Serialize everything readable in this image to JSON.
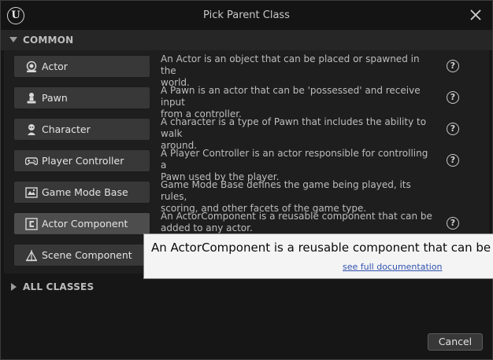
{
  "window": {
    "title": "Pick Parent Class",
    "logo_text": "U"
  },
  "sections": {
    "common": "COMMON",
    "all_classes": "ALL CLASSES"
  },
  "classes": [
    {
      "label": "Actor",
      "icon": "actor-icon",
      "desc1": "An Actor is an object that can be placed or spawned in the",
      "desc2": "world.",
      "help": "?"
    },
    {
      "label": "Pawn",
      "icon": "pawn-icon",
      "desc1": "A Pawn is an actor that can be 'possessed' and receive input",
      "desc2": "from a controller.",
      "help": "?"
    },
    {
      "label": "Character",
      "icon": "character-icon",
      "desc1": "A character is a type of Pawn that includes the ability to walk",
      "desc2": "around.",
      "help": "?"
    },
    {
      "label": "Player Controller",
      "icon": "gamepad-icon",
      "desc1": "A Player Controller is an actor responsible for controlling a",
      "desc2": "Pawn used by the player.",
      "help": "?"
    },
    {
      "label": "Game Mode Base",
      "icon": "game-mode-icon",
      "desc1": "Game Mode Base defines the game being played, its rules,",
      "desc2": "scoring, and other facets of the game type.",
      "help": ""
    },
    {
      "label": "Actor Component",
      "icon": "actor-component-icon",
      "desc1": "An ActorComponent is a reusable component that can be",
      "desc2": "added to any actor.",
      "help": "?"
    },
    {
      "label": "Scene Component",
      "icon": "scene-component-icon",
      "desc1": "",
      "desc2": "",
      "help": ""
    }
  ],
  "tooltip": {
    "text": "An ActorComponent is a reusable component that can be added to any actor.",
    "link": "see full documentation"
  },
  "buttons": {
    "cancel": "Cancel"
  },
  "colors": {
    "background": "#161616",
    "button": "#383838",
    "button_hover": "#4d4d4d",
    "tooltip_bg": "#f4f4f4",
    "link": "#3052b0"
  }
}
